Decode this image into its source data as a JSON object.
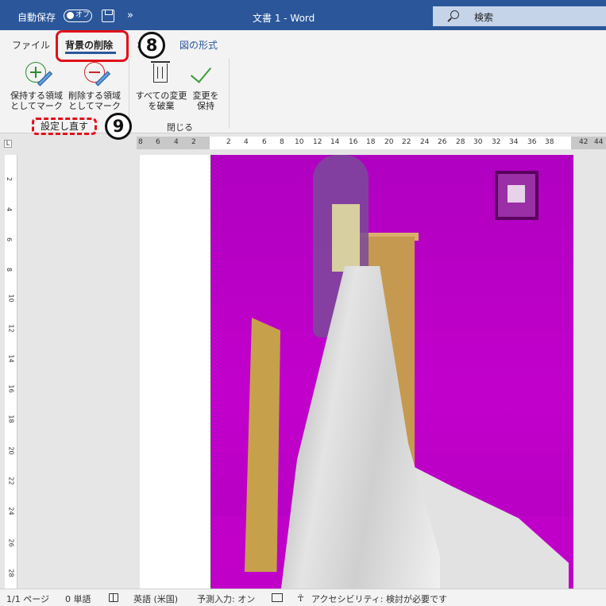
{
  "titlebar": {
    "autosave_label": "自動保存",
    "autosave_state": "オフ",
    "more": "»",
    "doc_title": "文書 1  -  Word",
    "search_placeholder": "検索"
  },
  "ribbon": {
    "tabs": {
      "file": "ファイル",
      "bg_removal": "背景の削除",
      "home_partial": "ホ",
      "picture_format": "図の形式"
    },
    "buttons": {
      "mark_keep_l1": "保持する領域",
      "mark_keep_l2": "としてマーク",
      "mark_remove_l1": "削除する領域",
      "mark_remove_l2": "としてマーク",
      "discard_l1": "すべての変更",
      "discard_l2": "を破棄",
      "keep_l1": "変更を",
      "keep_l2": "保持"
    },
    "groups": {
      "refine": "設定し直す",
      "close": "閉じる"
    },
    "annotations": {
      "step8": "8",
      "step9": "9"
    }
  },
  "ruler": {
    "corner": "L",
    "h_ticks": [
      "8",
      "6",
      "4",
      "2",
      "2",
      "4",
      "6",
      "8",
      "10",
      "12",
      "14",
      "16",
      "18",
      "20",
      "22",
      "24",
      "26",
      "28",
      "30",
      "32",
      "34",
      "36",
      "38",
      "42",
      "44"
    ],
    "v_ticks": [
      "2",
      "4",
      "6",
      "8",
      "10",
      "12",
      "14",
      "16",
      "18",
      "20",
      "22",
      "24",
      "26",
      "28"
    ]
  },
  "statusbar": {
    "page": "1/1 ページ",
    "words": "0 単語",
    "language": "英語 (米国)",
    "predict": "予測入力: オン",
    "accessibility": "アクセシビリティ: 検討が必要です"
  }
}
